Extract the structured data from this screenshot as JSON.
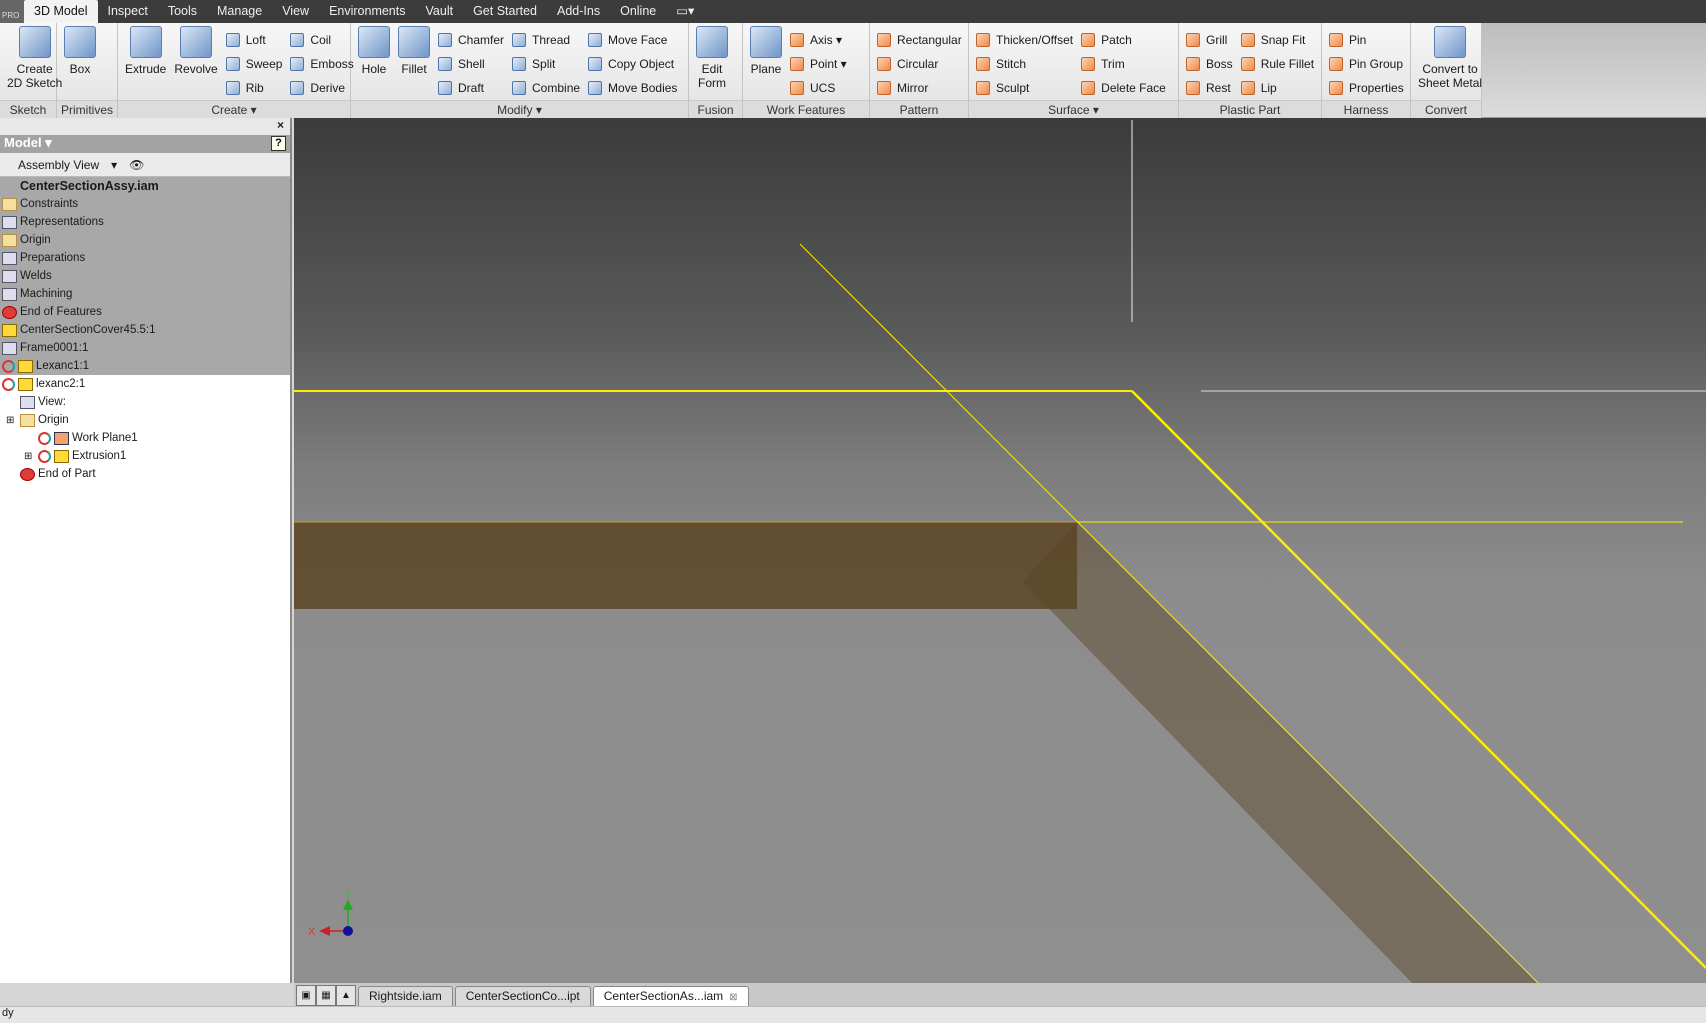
{
  "menubar": {
    "badge": "PRO",
    "tabs": [
      "3D Model",
      "Inspect",
      "Tools",
      "Manage",
      "View",
      "Environments",
      "Vault",
      "Get Started",
      "Add-Ins",
      "Online"
    ],
    "active": "3D Model"
  },
  "ribbon": {
    "panels": [
      {
        "label": "Sketch",
        "w": 57,
        "big": [
          "Create\n2D Sketch"
        ],
        "cols": []
      },
      {
        "label": "Primitives",
        "w": 61,
        "big": [
          "Box"
        ],
        "cols": []
      },
      {
        "label": "Create ▾",
        "w": 233,
        "big": [
          "Extrude",
          "Revolve"
        ],
        "cols": [
          [
            "Loft",
            "Sweep",
            "Rib"
          ],
          [
            "Coil",
            "Emboss",
            "Derive"
          ]
        ]
      },
      {
        "label": "Modify ▾",
        "w": 338,
        "big": [
          "Hole",
          "Fillet"
        ],
        "cols": [
          [
            "Chamfer",
            "Shell",
            "Draft"
          ],
          [
            "Thread",
            "Split",
            "Combine"
          ],
          [
            "Move Face",
            "Copy Object",
            "Move Bodies"
          ]
        ]
      },
      {
        "label": "Fusion",
        "w": 54,
        "big": [
          "Edit\nForm"
        ],
        "cols": []
      },
      {
        "label": "Work Features",
        "w": 127,
        "big": [
          "Plane"
        ],
        "cols": [
          [
            "Axis ▾",
            "Point ▾",
            "UCS"
          ]
        ]
      },
      {
        "label": "Pattern",
        "w": 99,
        "big": [],
        "cols": [
          [
            "Rectangular",
            "Circular",
            "Mirror"
          ]
        ]
      },
      {
        "label": "Surface ▾",
        "w": 210,
        "big": [],
        "cols": [
          [
            "Thicken/Offset",
            "Stitch",
            "Sculpt"
          ],
          [
            "Patch",
            "Trim",
            "Delete Face"
          ]
        ]
      },
      {
        "label": "Plastic Part",
        "w": 143,
        "big": [],
        "cols": [
          [
            "Grill",
            "Boss",
            "Rest"
          ],
          [
            "Snap Fit",
            "Rule Fillet",
            "Lip"
          ]
        ]
      },
      {
        "label": "Harness",
        "w": 89,
        "big": [],
        "cols": [
          [
            "Pin",
            "Pin Group",
            "Properties"
          ]
        ]
      },
      {
        "label": "Convert",
        "w": 71,
        "big": [
          "Convert to\nSheet Metal"
        ],
        "cols": []
      }
    ]
  },
  "browser": {
    "close": "×",
    "title": "Model ▾",
    "help": "?",
    "view": "Assembly View",
    "view_arrow": "▾",
    "find_icon": "binoculars-icon",
    "nodes": [
      {
        "label": "CenterSectionAssy.iam",
        "icon": "assembly",
        "indent": 0,
        "sel": true,
        "root": true
      },
      {
        "label": "Constraints",
        "icon": "folder",
        "indent": 0,
        "sel": true
      },
      {
        "label": "Representations",
        "icon": "gen",
        "indent": 0,
        "sel": true
      },
      {
        "label": "Origin",
        "icon": "folder",
        "indent": 0,
        "sel": true
      },
      {
        "label": "Preparations",
        "icon": "gen",
        "indent": 0,
        "sel": true
      },
      {
        "label": "Welds",
        "icon": "gen",
        "indent": 0,
        "sel": true
      },
      {
        "label": "Machining",
        "icon": "gen",
        "indent": 0,
        "sel": true
      },
      {
        "label": "End of Features",
        "icon": "err",
        "indent": 0,
        "sel": true
      },
      {
        "label": "CenterSectionCover45.5:1",
        "icon": "part",
        "indent": 0,
        "sel": true
      },
      {
        "label": "Frame0001:1",
        "icon": "gen",
        "indent": 0,
        "sel": true
      },
      {
        "label": "Lexanc1:1",
        "icon": "part",
        "indent": 0,
        "sel": true,
        "upd": true
      },
      {
        "label": "lexanc2:1",
        "icon": "part",
        "indent": 0,
        "upd": true
      },
      {
        "label": "View:",
        "icon": "gen",
        "indent": 1
      },
      {
        "label": "Origin",
        "icon": "folder",
        "indent": 1,
        "expand": true
      },
      {
        "label": "Work Plane1",
        "icon": "plane",
        "indent": 2,
        "upd": true
      },
      {
        "label": "Extrusion1",
        "icon": "part",
        "indent": 2,
        "upd": true,
        "expand": true
      },
      {
        "label": "End of Part",
        "icon": "err",
        "indent": 1
      }
    ]
  },
  "viewport": {
    "sketch_color": "#ffee00",
    "body_color": "#5a4424",
    "triad": {
      "x": "X",
      "y": "Y"
    }
  },
  "doc_tabs": {
    "tabs": [
      "Rightside.iam",
      "CenterSectionCo...ipt",
      "CenterSectionAs...iam"
    ],
    "active": 2,
    "close": "⊠"
  },
  "status": {
    "text": "dy"
  }
}
